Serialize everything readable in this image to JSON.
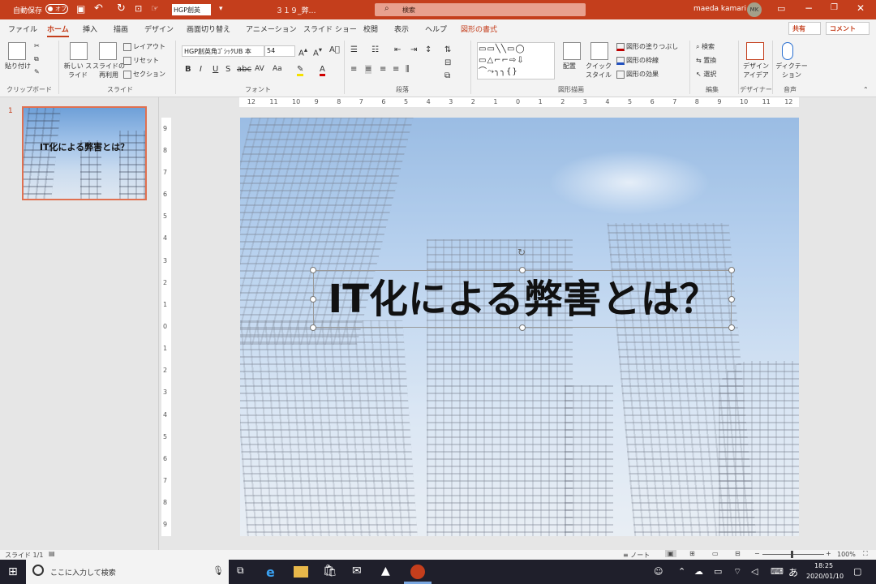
{
  "titlebar": {
    "autosave_label": "自動保存",
    "autosave_state": "オフ",
    "font_box": "HGP創英",
    "filename": "３１９_弊…",
    "search_placeholder": "検索",
    "user_name": "maeda kamari",
    "user_initials": "MK"
  },
  "tabs": [
    "ファイル",
    "ホーム",
    "挿入",
    "描画",
    "デザイン",
    "画面切り替え",
    "アニメーション",
    "スライド ショー",
    "校閲",
    "表示",
    "ヘルプ",
    "図形の書式"
  ],
  "active_tab": "ホーム",
  "share_label": "共有",
  "comment_label": "コメント",
  "ribbon": {
    "clipboard": {
      "paste": "貼り付け",
      "group": "クリップボード"
    },
    "slides": {
      "new_slide": "新しい スライド",
      "reuse": "スライドの 再利用",
      "layout": "レイアウト",
      "reset": "リセット",
      "section": "セクション",
      "group": "スライド"
    },
    "font": {
      "font_name": "HGP創英角ｺﾞｼｯｸUB 本",
      "font_size": "54",
      "group": "フォント"
    },
    "paragraph": {
      "group": "段落"
    },
    "drawing": {
      "arrange": "配置",
      "quick_style": "クイック スタイル",
      "fill": "図形の塗りつぶし",
      "outline": "図形の枠線",
      "effect": "図形の効果",
      "group": "図形描画"
    },
    "editing": {
      "find": "検索",
      "replace": "置換",
      "select": "選択",
      "group": "編集"
    },
    "designer": {
      "label": "デザイン アイデア",
      "group": "デザイナー"
    },
    "voice": {
      "label": "ディクテー ション",
      "group": "音声"
    }
  },
  "thumbnail": {
    "number": "1",
    "title": "IT化による弊害とは？"
  },
  "slide": {
    "title": "IT化による弊害とは？"
  },
  "ruler_h": [
    "12",
    "11",
    "10",
    "9",
    "8",
    "7",
    "6",
    "5",
    "4",
    "3",
    "2",
    "1",
    "0",
    "1",
    "2",
    "3",
    "4",
    "5",
    "6",
    "7",
    "8",
    "9",
    "10",
    "11",
    "12"
  ],
  "ruler_v": [
    "9",
    "8",
    "7",
    "6",
    "5",
    "4",
    "3",
    "2",
    "1",
    "0",
    "1",
    "2",
    "3",
    "4",
    "5",
    "6",
    "7",
    "8",
    "9"
  ],
  "status": {
    "slide_count": "スライド 1/1",
    "notes": "ノート",
    "zoom": "100%"
  },
  "taskbar": {
    "search_placeholder": "ここに入力して検索",
    "time": "18:25",
    "date": "2020/01/10",
    "ime": "あ"
  }
}
